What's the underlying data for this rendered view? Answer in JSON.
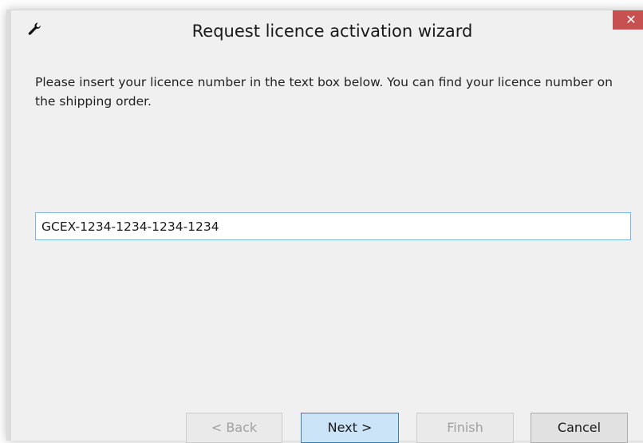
{
  "window": {
    "title": "Request licence activation wizard",
    "close_glyph": "✕",
    "title_icon": "wrench-icon"
  },
  "main": {
    "instruction": "Please insert your licence number in the text box below. You can find your licence number on the shipping order.",
    "licence_value": "GCEX-1234-1234-1234-1234"
  },
  "buttons": {
    "back": "< Back",
    "next": "Next >",
    "finish": "Finish",
    "cancel": "Cancel"
  },
  "colors": {
    "window_bg": "#f0f0f0",
    "close_button": "#c75050",
    "input_border": "#7ab4e0",
    "primary_button": "#cce4f7"
  }
}
